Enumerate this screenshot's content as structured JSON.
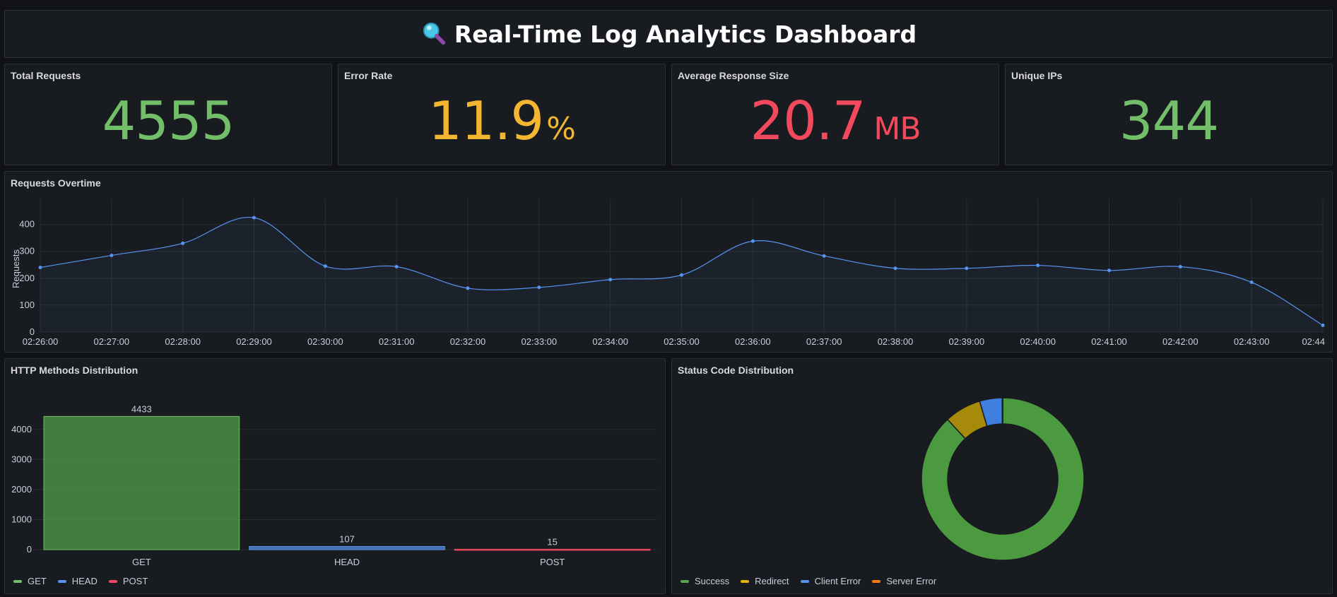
{
  "dashboard": {
    "title": "Real-Time Log Analytics Dashboard",
    "title_icon": "magnifying-glass-icon"
  },
  "stats": {
    "total_requests": {
      "label": "Total Requests",
      "value": "4555",
      "color": "#73bf69"
    },
    "error_rate": {
      "label": "Error Rate",
      "value": "11.9",
      "unit": "%",
      "color": "#f2b631"
    },
    "avg_response_size": {
      "label": "Average Response Size",
      "value": "20.7",
      "unit": "MB",
      "color": "#f2495c"
    },
    "unique_ips": {
      "label": "Unique IPs",
      "value": "344",
      "color": "#73bf69"
    }
  },
  "requests_panel": {
    "title": "Requests Overtime"
  },
  "methods_panel": {
    "title": "HTTP Methods Distribution"
  },
  "status_panel": {
    "title": "Status Code Distribution"
  },
  "chart_data": [
    {
      "type": "line",
      "title": "Requests Overtime",
      "ylabel": "Requests",
      "ylim": [
        0,
        470
      ],
      "yticks": [
        0,
        100,
        200,
        300,
        400
      ],
      "x": [
        "02:26:00",
        "02:27:00",
        "02:28:00",
        "02:29:00",
        "02:30:00",
        "02:31:00",
        "02:32:00",
        "02:33:00",
        "02:34:00",
        "02:35:00",
        "02:36:00",
        "02:37:00",
        "02:38:00",
        "02:39:00",
        "02:40:00",
        "02:41:00",
        "02:42:00",
        "02:43:00",
        "02:44"
      ],
      "series": [
        {
          "values": [
            240,
            285,
            330,
            425,
            245,
            243,
            163,
            166,
            195,
            212,
            338,
            283,
            237,
            237,
            248,
            229,
            243,
            185,
            25
          ],
          "color": "#5794f2"
        }
      ],
      "grid": true
    },
    {
      "type": "bar",
      "title": "HTTP Methods Distribution",
      "categories": [
        "GET",
        "HEAD",
        "POST"
      ],
      "values": [
        4433,
        107,
        15
      ],
      "data_labels": [
        "4433",
        "107",
        "15"
      ],
      "colors": [
        "#73bf69",
        "#5794f2",
        "#f2495c"
      ],
      "ylim": [
        0,
        4700
      ],
      "yticks": [
        0,
        1000,
        2000,
        3000,
        4000
      ],
      "legend": [
        "GET",
        "HEAD",
        "POST"
      ],
      "legend_position": "bottom-left"
    },
    {
      "type": "pie",
      "title": "Status Code Distribution",
      "donut": true,
      "categories": [
        "Success",
        "Redirect",
        "Client Error",
        "Server Error"
      ],
      "values": [
        88.1,
        7.3,
        4.5,
        0.1
      ],
      "colors": [
        "#56a64b",
        "#e0b400",
        "#5794f2",
        "#ff780a"
      ],
      "legend": [
        "Success",
        "Redirect",
        "Client Error",
        "Server Error"
      ],
      "legend_position": "bottom-left"
    }
  ]
}
